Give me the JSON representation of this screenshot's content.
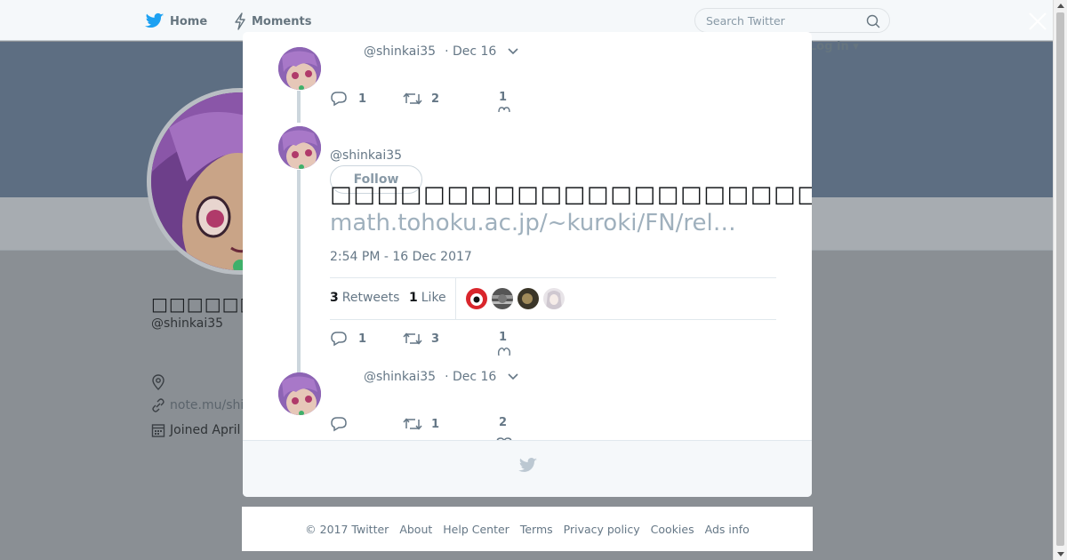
{
  "nav": {
    "home_label": "Home",
    "moments_label": "Moments",
    "search_placeholder": "Search Twitter",
    "login_label": "Log in"
  },
  "profile": {
    "name": "□□□□□□□□□□",
    "handle": "@shinkai35",
    "website": "note.mu/shi",
    "joined": "Joined April"
  },
  "thread": {
    "prev_tweet": {
      "handle": "@shinkai35",
      "date": "· Dec 16",
      "replies": "1",
      "retweets": "2",
      "likes": "1"
    },
    "main_tweet": {
      "handle": "@shinkai35",
      "follow_label": "Follow",
      "text": "□□□□□□□□□□□□□□□□□□□□□□□□□□□□□□□□□□□□□□□□□□",
      "link": "math.tohoku.ac.jp/~kuroki/FN/rel…",
      "timestamp": "2:54 PM - 16 Dec 2017",
      "retweet_count": "3",
      "retweet_label": "Retweets",
      "like_count": "1",
      "like_label": "Like",
      "replies": "1",
      "retweets": "3",
      "likes": "1"
    },
    "next_tweet": {
      "handle": "@shinkai35",
      "date": "· Dec 16",
      "replies": "",
      "retweets": "1",
      "likes": "2"
    }
  },
  "footer": {
    "links": [
      "© 2017 Twitter",
      "About",
      "Help Center",
      "Terms",
      "Privacy policy",
      "Cookies",
      "Ads info"
    ]
  },
  "colors": {
    "overlay": "#8a8f94",
    "link_muted": "#9fb0bd",
    "text_secondary": "#657786"
  }
}
